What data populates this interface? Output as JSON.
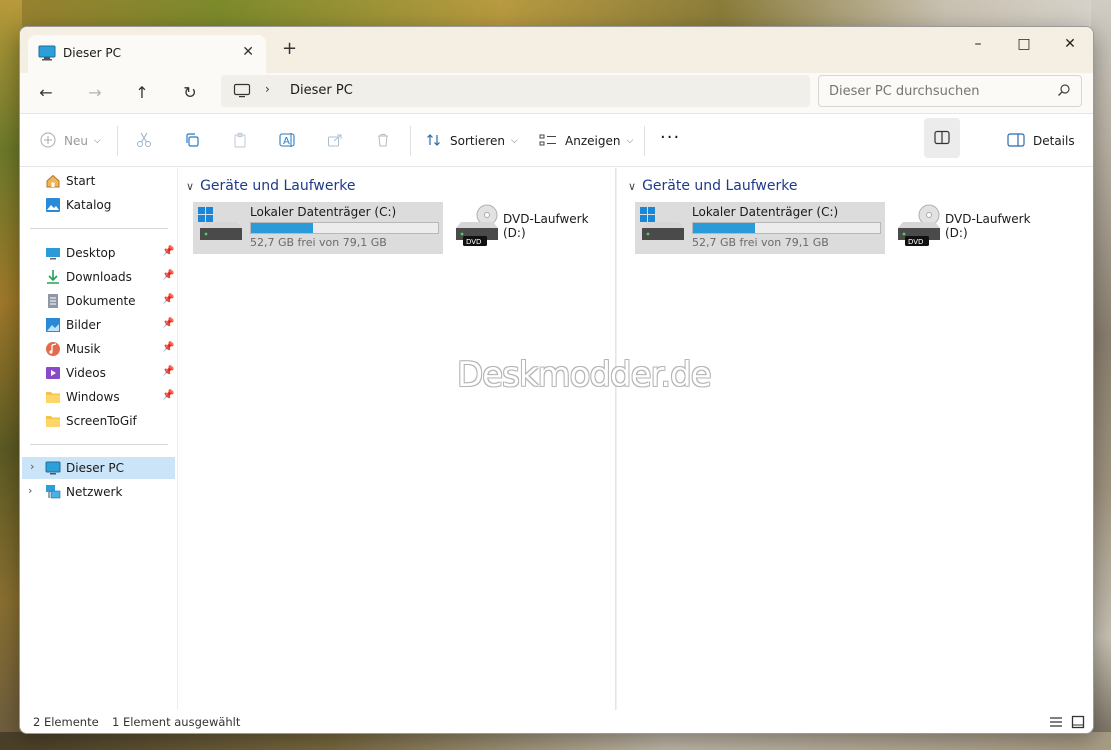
{
  "window": {
    "tab_title": "Dieser PC",
    "new_tab_label": "+"
  },
  "titlebar": {
    "minimize": "–",
    "maximize": "□",
    "close": "✕"
  },
  "navigation": {
    "back": "←",
    "forward": "→",
    "up": "↑",
    "refresh": "↻"
  },
  "address": {
    "separator": "›",
    "crumb": "Dieser PC"
  },
  "search": {
    "placeholder": "Dieser PC durchsuchen"
  },
  "toolbar": {
    "new_label": "Neu",
    "sort_label": "Sortieren",
    "view_label": "Anzeigen",
    "more_label": "···",
    "details_label": "Details"
  },
  "sidebar": {
    "quick": [
      {
        "label": "Start",
        "icon": "home-icon"
      },
      {
        "label": "Katalog",
        "icon": "gallery-icon"
      }
    ],
    "pinned": [
      {
        "label": "Desktop",
        "icon": "desktop-icon"
      },
      {
        "label": "Downloads",
        "icon": "download-icon"
      },
      {
        "label": "Dokumente",
        "icon": "document-icon"
      },
      {
        "label": "Bilder",
        "icon": "pictures-icon"
      },
      {
        "label": "Musik",
        "icon": "music-icon"
      },
      {
        "label": "Videos",
        "icon": "videos-icon"
      },
      {
        "label": "Windows",
        "icon": "folder-icon"
      },
      {
        "label": "ScreenToGif",
        "icon": "folder-icon"
      }
    ],
    "tree": [
      {
        "label": "Dieser PC",
        "icon": "this-pc-icon",
        "selected": true
      },
      {
        "label": "Netzwerk",
        "icon": "network-icon",
        "selected": false
      }
    ]
  },
  "panes": [
    {
      "group_header": "Geräte und Laufwerke",
      "drives": [
        {
          "name": "Lokaler Datenträger (C:)",
          "free_text": "52,7 GB frei von 79,1 GB",
          "used_fraction": 0.334,
          "selected": true
        },
        {
          "name": "DVD-Laufwerk (D:)",
          "badge": "DVD"
        }
      ]
    },
    {
      "group_header": "Geräte und Laufwerke",
      "drives": [
        {
          "name": "Lokaler Datenträger (C:)",
          "free_text": "52,7 GB frei von 79,1 GB",
          "used_fraction": 0.334,
          "selected": true
        },
        {
          "name": "DVD-Laufwerk (D:)",
          "badge": "DVD"
        }
      ]
    }
  ],
  "watermark": "Deskmodder.de",
  "status": {
    "count": "2 Elemente",
    "selection": "1 Element ausgewählt"
  },
  "colors": {
    "accent": "#2a9ad8",
    "selection": "#cce4f7",
    "group_header": "#1f3a8a"
  }
}
